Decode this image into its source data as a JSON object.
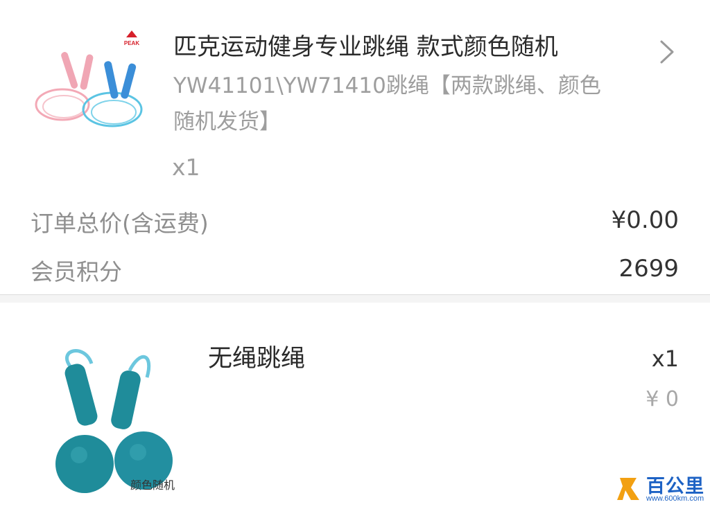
{
  "order_item": {
    "title": "匹克运动健身专业跳绳 款式颜色随机",
    "spec": "YW41101\\YW71410跳绳【两款跳绳、颜色随机发货】",
    "quantity": "x1",
    "brand_logo_text": "PEAK",
    "chevron_icon": "chevron-right-icon"
  },
  "summary": {
    "total_label": "订单总价(含运费)",
    "total_value": "¥0.00",
    "points_label": "会员积分",
    "points_value": "2699"
  },
  "gift_item": {
    "name": "无绳跳绳",
    "quantity": "x1",
    "price": "¥ 0",
    "image_caption": "颜色随机"
  },
  "watermark": {
    "text": "百公里",
    "url": "www.600km.com"
  },
  "colors": {
    "rope_pink": "#f3a9b6",
    "rope_blue": "#3b8ed8",
    "ball_teal": "#1f8c9a",
    "peak_red": "#d6202b",
    "watermark_blue": "#1d62c4"
  }
}
